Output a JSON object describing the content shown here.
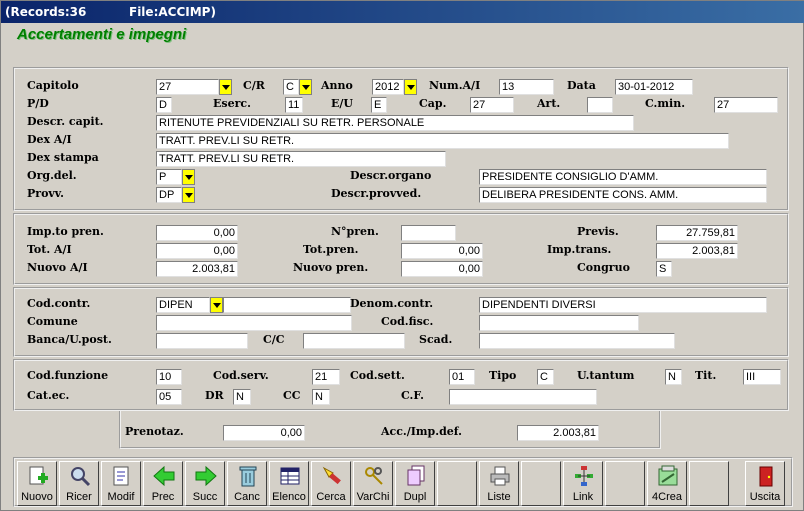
{
  "window": {
    "records": "(Records:36",
    "file": "File:ACCIMP)"
  },
  "form_title": "Accertamenti e impegni",
  "labels": {
    "capitolo": "Capitolo",
    "cr": "C/R",
    "anno": "Anno",
    "num_ai": "Num.A/I",
    "data": "Data",
    "pd": "P/D",
    "eserc": "Eserc.",
    "eu": "E/U",
    "cap": "Cap.",
    "art": "Art.",
    "cmin": "C.min.",
    "descr_capit": "Descr. capit.",
    "dex_ai": "Dex A/I",
    "dex_stampa": "Dex stampa",
    "org_del": "Org.del.",
    "descr_organo": "Descr.organo",
    "provv": "Provv.",
    "descr_provved": "Descr.provved.",
    "imp_pren": "Imp.to pren.",
    "n_pren": "N°pren.",
    "previs": "Previs.",
    "tot_ai": "Tot. A/I",
    "tot_pren": "Tot.pren.",
    "imp_trans": "Imp.trans.",
    "nuovo_ai": "Nuovo A/I",
    "nuovo_pren": "Nuovo pren.",
    "congruo": "Congruo",
    "cod_contr": "Cod.contr.",
    "denom_contr": "Denom.contr.",
    "comune": "Comune",
    "cod_fisc": "Cod.fisc.",
    "banca": "Banca/U.post.",
    "cc": "C/C",
    "scad": "Scad.",
    "cod_funzione": "Cod.funzione",
    "cod_serv": "Cod.serv.",
    "cod_sett": "Cod.sett.",
    "tipo": "Tipo",
    "utantum": "U.tantum",
    "tit": "Tit.",
    "cat_ec": "Cat.ec.",
    "dr": "DR",
    "cc2": "CC",
    "cf": "C.F.",
    "prenotaz": "Prenotaz.",
    "acc_imp_def": "Acc./Imp.def."
  },
  "values": {
    "capitolo": "27",
    "cr": "C",
    "anno": "2012",
    "num_ai": "13",
    "data": "30-01-2012",
    "pd": "D",
    "eserc": "11",
    "eu": "E",
    "cap": "27",
    "art": "",
    "cmin": "27",
    "descr_capit": "RITENUTE PREVIDENZIALI SU RETR. PERSONALE",
    "dex_ai": "TRATT. PREV.LI SU RETR.",
    "dex_stampa": "TRATT. PREV.LI SU RETR.",
    "org_del": "P",
    "descr_organo": "PRESIDENTE CONSIGLIO D'AMM.",
    "provv": "DP",
    "descr_provved": "DELIBERA PRESIDENTE CONS. AMM.",
    "imp_pren": "0,00",
    "n_pren": "",
    "previs": "27.759,81",
    "tot_ai": "0,00",
    "tot_pren": "0,00",
    "imp_trans": "2.003,81",
    "nuovo_ai": "2.003,81",
    "nuovo_pren": "0,00",
    "congruo": "S",
    "cod_contr": "DIPEN",
    "denom_contr": "DIPENDENTI DIVERSI",
    "comune": "",
    "cod_fisc": "",
    "banca": "",
    "cc": "",
    "scad": "",
    "cod_funzione": "10",
    "cod_serv": "21",
    "cod_sett": "01",
    "tipo": "C",
    "utantum": "N",
    "tit": "III",
    "cat_ec": "05",
    "dr": "N",
    "cc2": "N",
    "cf": "",
    "prenotaz": "0,00",
    "acc_imp_def": "2.003,81"
  },
  "toolbar": [
    "Nuovo",
    "Ricer",
    "Modif",
    "Prec",
    "Succ",
    "Canc",
    "Elenco",
    "Cerca",
    "VarChi",
    "Dupl",
    "",
    "Liste",
    "",
    "Link",
    "",
    "4Crea",
    "",
    "Uscita"
  ],
  "colors": {
    "title_green": "#008000",
    "dropdown": "#ffff00",
    "titlebar": "#0a246a"
  }
}
